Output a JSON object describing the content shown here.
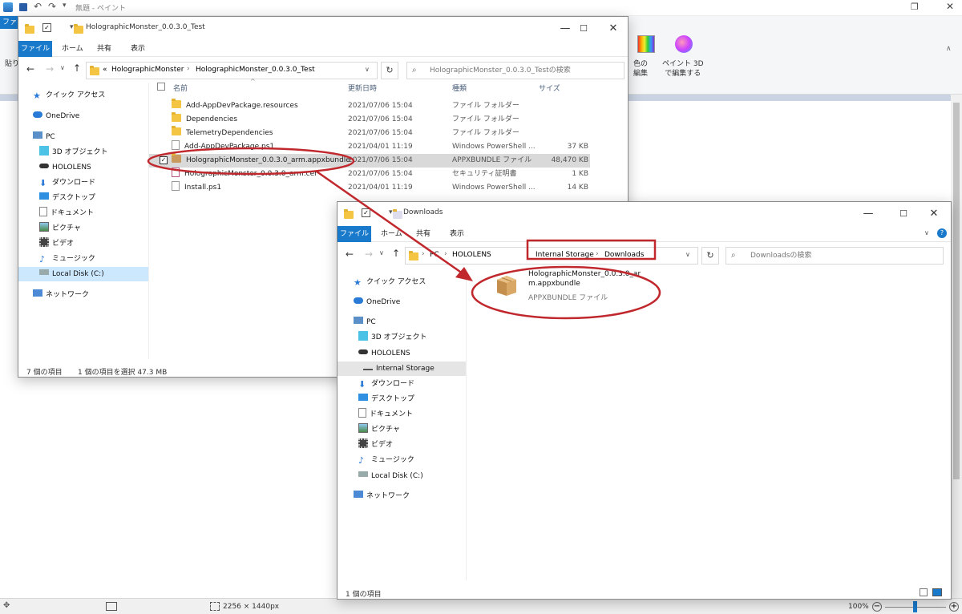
{
  "paint": {
    "title": "無題 - ペイント",
    "tab_file": "ファ",
    "paste_label": "貼り",
    "edit_colors_label": "色の\n編集",
    "paint3d_label": "ペイント 3D\nで編集する",
    "status_size": "2256 × 1440px",
    "zoom": "100%",
    "colors": {
      "ribbon_bg": "#f5f6f7",
      "canvas_bg": "#c9d3e2"
    }
  },
  "explorer1": {
    "title": "HolographicMonster_0.0.3.0_Test",
    "tabs": {
      "file": "ファイル",
      "home": "ホーム",
      "share": "共有",
      "view": "表示"
    },
    "breadcrumb": {
      "prefix": "«",
      "part1": "HolographicMonster",
      "part2": "HolographicMonster_0.0.3.0_Test"
    },
    "search_placeholder": "HolographicMonster_0.0.3.0_Testの検索",
    "nav": {
      "quick_access": "クイック アクセス",
      "onedrive": "OneDrive",
      "pc": "PC",
      "objects3d": "3D オブジェクト",
      "hololens": "HOLOLENS",
      "downloads": "ダウンロード",
      "desktop": "デスクトップ",
      "documents": "ドキュメント",
      "pictures": "ピクチャ",
      "videos": "ビデオ",
      "music": "ミュージック",
      "local_disk": "Local Disk (C:)",
      "network": "ネットワーク"
    },
    "headers": {
      "name": "名前",
      "date": "更新日時",
      "type": "種類",
      "size": "サイズ"
    },
    "files": [
      {
        "name": "Add-AppDevPackage.resources",
        "date": "2021/07/06 15:04",
        "type": "ファイル フォルダー",
        "size": ""
      },
      {
        "name": "Dependencies",
        "date": "2021/07/06 15:04",
        "type": "ファイル フォルダー",
        "size": ""
      },
      {
        "name": "TelemetryDependencies",
        "date": "2021/07/06 15:04",
        "type": "ファイル フォルダー",
        "size": ""
      },
      {
        "name": "Add-AppDevPackage.ps1",
        "date": "2021/04/01 11:19",
        "type": "Windows PowerShell ...",
        "size": "37 KB"
      },
      {
        "name": "HolographicMonster_0.0.3.0_arm.appxbundle",
        "date": "2021/07/06 15:04",
        "type": "APPXBUNDLE ファイル",
        "size": "48,470 KB"
      },
      {
        "name": "HolographicMonster_0.0.3.0_arm.cer",
        "date": "2021/07/06 15:04",
        "type": "セキュリティ証明書",
        "size": "1 KB"
      },
      {
        "name": "Install.ps1",
        "date": "2021/04/01 11:19",
        "type": "Windows PowerShell ...",
        "size": "14 KB"
      }
    ],
    "status_count": "7 個の項目",
    "status_selected": "1 個の項目を選択  47.3 MB"
  },
  "explorer2": {
    "title": "Downloads",
    "tabs": {
      "file": "ファイル",
      "home": "ホーム",
      "share": "共有",
      "view": "表示"
    },
    "breadcrumb": {
      "part1": "PC",
      "part2": "HOLOLENS",
      "part3": "Internal Storage",
      "part4": "Downloads"
    },
    "search_placeholder": "Downloadsの検索",
    "nav": {
      "quick_access": "クイック アクセス",
      "onedrive": "OneDrive",
      "pc": "PC",
      "objects3d": "3D オブジェクト",
      "hololens": "HOLOLENS",
      "internal_storage": "Internal Storage",
      "downloads": "ダウンロード",
      "desktop": "デスクトップ",
      "documents": "ドキュメント",
      "pictures": "ピクチャ",
      "videos": "ビデオ",
      "music": "ミュージック",
      "local_disk": "Local Disk (C:)",
      "network": "ネットワーク"
    },
    "item": {
      "name_line1": "HolographicMonster_0.0.3.0_ar",
      "name_line2": "m.appxbundle",
      "type": "APPXBUNDLE ファイル"
    },
    "status_count": "1 個の項目"
  },
  "annotation_color": "#c0282d"
}
